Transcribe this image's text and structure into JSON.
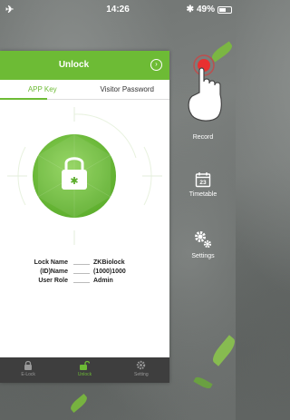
{
  "status_bar": {
    "time": "14:26",
    "battery": "49%",
    "battery_level": 0.49
  },
  "header": {
    "title": "Unlock"
  },
  "tabs": [
    {
      "label": "APP Key",
      "active": true
    },
    {
      "label": "Visitor Password",
      "active": false
    }
  ],
  "lock_info": [
    {
      "key": "Lock Name",
      "value": "ZKBiolock"
    },
    {
      "key": "(ID)Name",
      "value": "(1000)1000"
    },
    {
      "key": "User Role",
      "value": "Admin"
    }
  ],
  "side_menu": {
    "record": "Record",
    "timetable": "Timetable",
    "timetable_date": "23",
    "settings": "Settings"
  },
  "bottom_nav": [
    {
      "label": "E-Lock",
      "icon": "lock-icon",
      "active": false
    },
    {
      "label": "Unlock",
      "icon": "unlock-icon",
      "active": true
    },
    {
      "label": "Setting",
      "icon": "gear-icon",
      "active": false
    }
  ],
  "colors": {
    "accent": "#6dbb35",
    "nav_bg": "#3e3e3e"
  }
}
